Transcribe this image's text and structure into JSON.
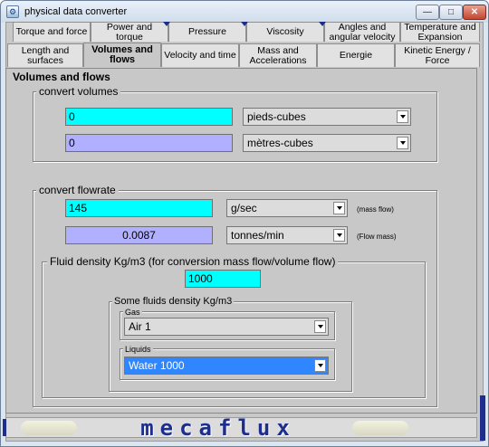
{
  "window": {
    "title": "physical data converter",
    "app_icon": "app-icon",
    "controls": {
      "minimize": "—",
      "maximize": "□",
      "close": "✕"
    }
  },
  "tabs_row1": [
    {
      "label": "Torque and force",
      "mark": false
    },
    {
      "label": "Power and torque",
      "mark": false
    },
    {
      "label": "Pressure",
      "mark": true
    },
    {
      "label": "Viscosity",
      "mark": true
    },
    {
      "label": "Angles and angular velocity",
      "mark": true
    },
    {
      "label": "Temperature and Expansion",
      "mark": false
    }
  ],
  "tabs_row2": [
    {
      "label": "Length and surfaces",
      "active": false
    },
    {
      "label": "Volumes and flows",
      "active": true
    },
    {
      "label": "Velocity and time",
      "active": false
    },
    {
      "label": "Mass and Accelerations",
      "active": false
    },
    {
      "label": "Energie",
      "active": false
    },
    {
      "label": "Kinetic Energy / Force",
      "active": false
    }
  ],
  "panel": {
    "title": "Volumes and flows",
    "volumes": {
      "label": "convert volumes",
      "value1": "0",
      "unit1": "pieds-cubes",
      "value2": "0",
      "unit2": "mètres-cubes"
    },
    "flowrate": {
      "label": "convert flowrate",
      "value1": "145",
      "unit1": "g/sec",
      "note1": "(mass flow)",
      "value2": "0.0087",
      "unit2": "tonnes/min",
      "note2": "(Flow mass)"
    },
    "density": {
      "label": "Fluid  density Kg/m3  (for conversion mass flow/volume flow)",
      "value": "1000",
      "fluids": {
        "label": "Some fluids density Kg/m3",
        "gas_label": "Gas",
        "gas_value": "Air 1",
        "liquids_label": "Liquids",
        "liquids_value": "Water 1000"
      }
    }
  },
  "footer": {
    "logo": "mecaflux"
  },
  "colors": {
    "input_cyan": "#00ffff",
    "input_lavender": "#b0b0ff",
    "selected_blue": "#2f86ff",
    "logo_blue": "#1d2e8e"
  }
}
